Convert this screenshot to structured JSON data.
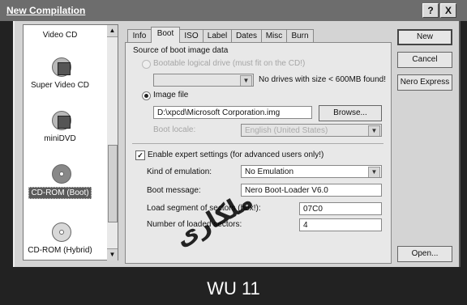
{
  "window": {
    "title": "New Compilation",
    "help_button": "?",
    "close_button": "X"
  },
  "left_list": {
    "items": [
      {
        "label": "Video CD",
        "icon": "video-cd-icon",
        "selected": false
      },
      {
        "label": "Super Video CD",
        "icon": "super-video-cd-icon",
        "selected": false
      },
      {
        "label": "miniDVD",
        "icon": "minidvd-icon",
        "selected": false
      },
      {
        "label": "CD-ROM (Boot)",
        "icon": "cd-rom-boot-icon",
        "selected": true
      },
      {
        "label": "CD-ROM (Hybrid)",
        "icon": "cd-rom-hybrid-icon",
        "selected": false
      }
    ],
    "scroll_up": "▲",
    "scroll_down": "▼"
  },
  "tabs": [
    "Info",
    "Boot",
    "ISO",
    "Label",
    "Dates",
    "Misc",
    "Burn"
  ],
  "active_tab": "Boot",
  "boot": {
    "section_title": "Source of boot image data",
    "bootable_drive_label": "Bootable logical drive (must fit on the CD!)",
    "no_drives_text": "No drives with size < 600MB found!",
    "image_file_label": "Image file",
    "image_file_value": "D:\\xpcd\\Microsoft Corporation.img",
    "browse_button": "Browse...",
    "boot_locale_label": "Boot locale:",
    "boot_locale_value": "English (United States)",
    "expert_settings_label": "Enable expert settings (for advanced users only!)",
    "expert_checked": "✓",
    "emulation_label": "Kind of emulation:",
    "emulation_value": "No Emulation",
    "boot_message_label": "Boot message:",
    "boot_message_value": "Nero Boot-Loader V6.0",
    "load_segment_label": "Load segment of sectors (hex!):",
    "load_segment_value": "07C0",
    "num_sectors_label": "Number of loaded sectors:",
    "num_sectors_value": "4"
  },
  "buttons": {
    "new": "New",
    "cancel": "Cancel",
    "nero_express": "Nero Express",
    "open": "Open..."
  },
  "watermark": "ملکاری",
  "caption": "WU 11"
}
